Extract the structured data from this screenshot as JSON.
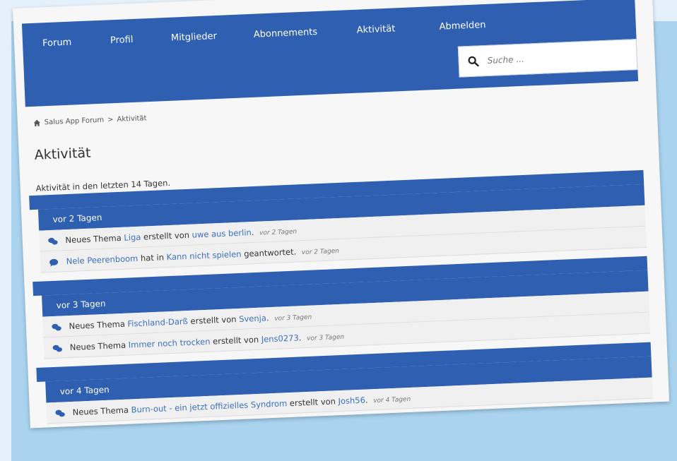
{
  "nav": {
    "items": [
      "Forum",
      "Profil",
      "Mitglieder",
      "Abonnements",
      "Aktivität",
      "Abmelden"
    ],
    "search_placeholder": "Suche ..."
  },
  "breadcrumb": {
    "home": "Salus App Forum",
    "separator": ">",
    "current": "Aktivität"
  },
  "page": {
    "title": "Aktivität",
    "intro": "Aktivität in den letzten 14 Tagen."
  },
  "groups": [
    {
      "header": "vor 2 Tagen",
      "items": [
        {
          "icon": "comments-icon",
          "prefix": "Neues Thema",
          "link1": "Liga",
          "middle": "erstellt von",
          "link2": "uwe aus berlin",
          "suffix": ".",
          "time": "vor 2 Tagen"
        },
        {
          "icon": "comment-icon",
          "prefix": "",
          "link1": "Nele Peerenboom",
          "middle": "hat in",
          "link2": "Kann nicht spielen",
          "suffix": "geantwortet.",
          "time": "vor 2 Tagen"
        }
      ]
    },
    {
      "header": "vor 3 Tagen",
      "items": [
        {
          "icon": "comments-icon",
          "prefix": "Neues Thema",
          "link1": "Fischland-Darß",
          "middle": "erstellt von",
          "link2": "Svenja",
          "suffix": ".",
          "time": "vor 3 Tagen"
        },
        {
          "icon": "comments-icon",
          "prefix": "Neues Thema",
          "link1": "Immer noch trocken",
          "middle": "erstellt von",
          "link2": "Jens0273",
          "suffix": ".",
          "time": "vor 3 Tagen"
        }
      ]
    },
    {
      "header": "vor 4 Tagen",
      "items": [
        {
          "icon": "comments-icon",
          "prefix": "Neues Thema",
          "link1": "Burn-out - ein jetzt offizielles Syndrom",
          "middle": "erstellt von",
          "link2": "Josh56",
          "suffix": ".",
          "time": "vor 4 Tagen"
        }
      ]
    }
  ],
  "colors": {
    "primary": "#2f5fb0",
    "link": "#3a6fc3",
    "frame": "#a9d3ef",
    "page_bg": "#e4f1fb"
  }
}
